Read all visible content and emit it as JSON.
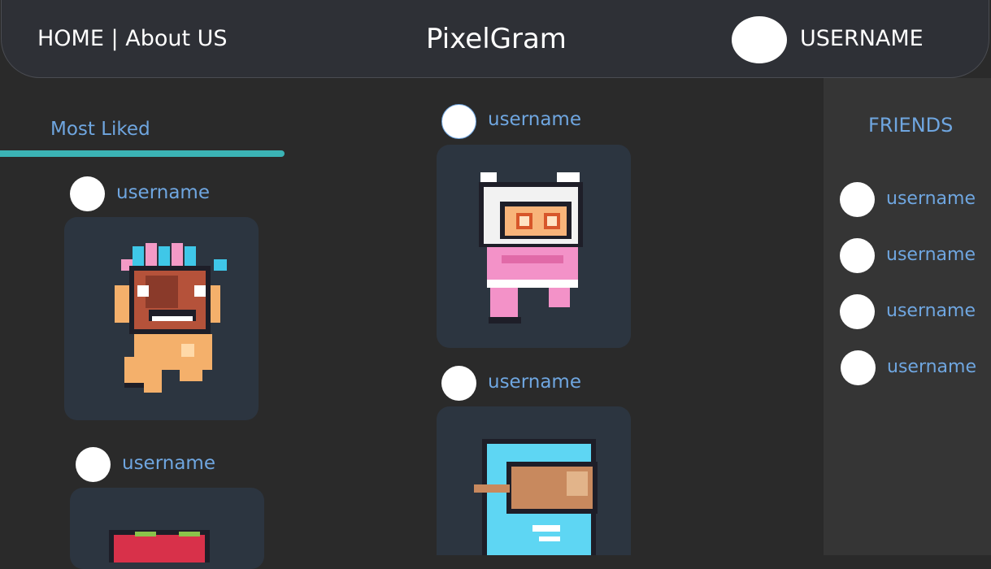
{
  "nav": {
    "home": "HOME",
    "separator": "|",
    "about": "About US",
    "brand": "PixelGram",
    "user": "USERNAME"
  },
  "section": {
    "most_liked": "Most Liked"
  },
  "friends": {
    "title": "FRIENDS",
    "items": [
      {
        "name": "username"
      },
      {
        "name": "username"
      },
      {
        "name": "username"
      },
      {
        "name": "username"
      }
    ]
  },
  "posts": {
    "left_1": {
      "username": "username",
      "image": "tiki-mask-character"
    },
    "left_2": {
      "username": "username",
      "image": "red-crab-character"
    },
    "center_1": {
      "username": "username",
      "image": "white-hooded-astronaut-character"
    },
    "center_2": {
      "username": "username",
      "image": "blue-astronaut-character"
    }
  },
  "colors": {
    "accent": "#6fa6e0",
    "underline": "#3bb3b5",
    "card": "#2c3540",
    "background": "#2a2a2a",
    "sidebar": "#353535"
  }
}
